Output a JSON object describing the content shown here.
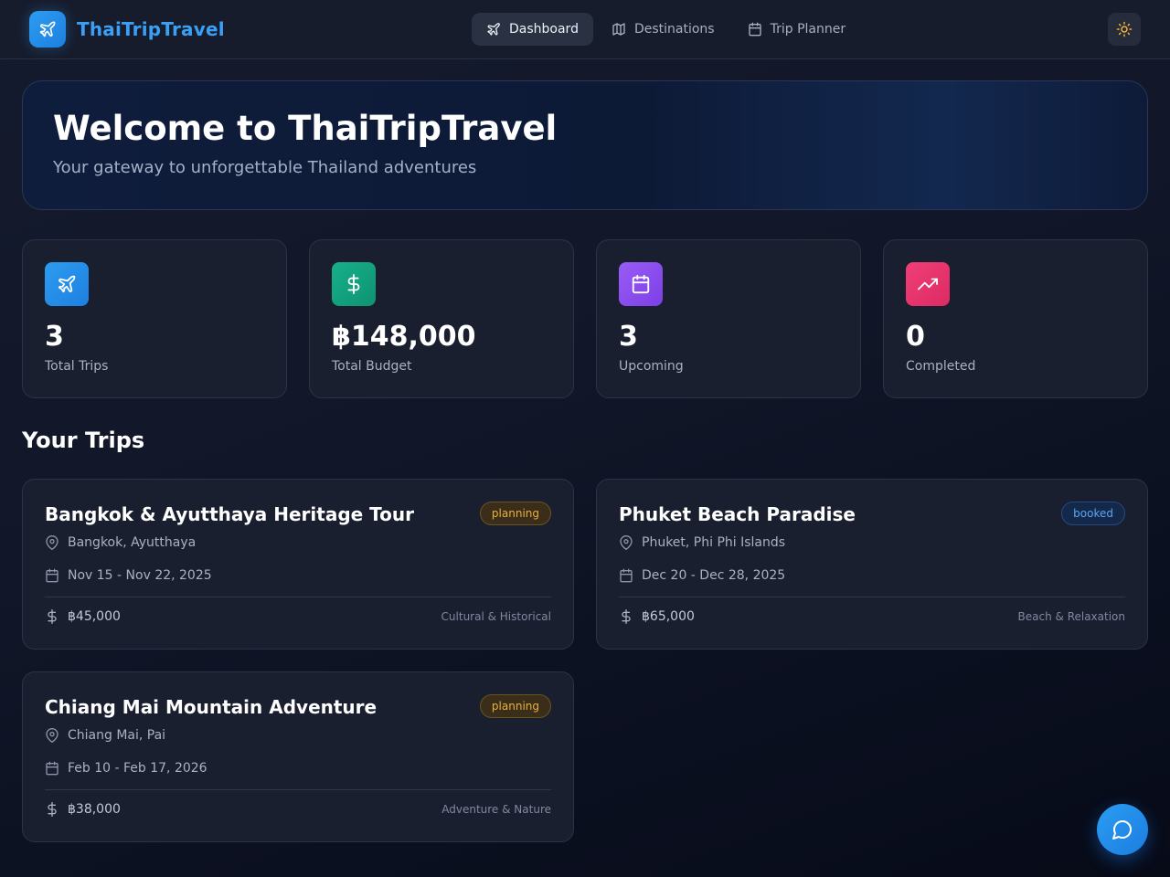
{
  "brand": {
    "name": "ThaiTripTravel",
    "icon": "plane-icon"
  },
  "nav": [
    {
      "label": "Dashboard",
      "icon": "plane-icon",
      "active": true
    },
    {
      "label": "Destinations",
      "icon": "map-icon",
      "active": false
    },
    {
      "label": "Trip Planner",
      "icon": "calendar-icon",
      "active": false
    }
  ],
  "theme_toggle": {
    "icon": "sun-icon"
  },
  "hero": {
    "title": "Welcome to ThaiTripTravel",
    "subtitle": "Your gateway to unforgettable Thailand adventures"
  },
  "stats": [
    {
      "value": "3",
      "label": "Total Trips",
      "icon": "plane-icon",
      "color": "#2592ea"
    },
    {
      "value": "฿148,000",
      "label": "Total Budget",
      "icon": "dollar-icon",
      "color": "#14a37f"
    },
    {
      "value": "3",
      "label": "Upcoming",
      "icon": "calendar-icon",
      "color": "#8b4ff0"
    },
    {
      "value": "0",
      "label": "Completed",
      "icon": "trending-up-icon",
      "color": "#ea3570"
    }
  ],
  "section_title": "Your Trips",
  "trips": [
    {
      "title": "Bangkok & Ayutthaya Heritage Tour",
      "status": "planning",
      "location": "Bangkok, Ayutthaya",
      "dates": "Nov 15 - Nov 22, 2025",
      "budget": "฿45,000",
      "category": "Cultural & Historical"
    },
    {
      "title": "Phuket Beach Paradise",
      "status": "booked",
      "location": "Phuket, Phi Phi Islands",
      "dates": "Dec 20 - Dec 28, 2025",
      "budget": "฿65,000",
      "category": "Beach & Relaxation"
    },
    {
      "title": "Chiang Mai Mountain Adventure",
      "status": "planning",
      "location": "Chiang Mai, Pai",
      "dates": "Feb 10 - Feb 17, 2026",
      "budget": "฿38,000",
      "category": "Adventure & Nature"
    }
  ],
  "chat_button": {
    "icon": "chat-icon"
  },
  "colors": {
    "accent": "#2d9cf0",
    "planning": "#e8b23a",
    "booked": "#5aa5f5"
  }
}
